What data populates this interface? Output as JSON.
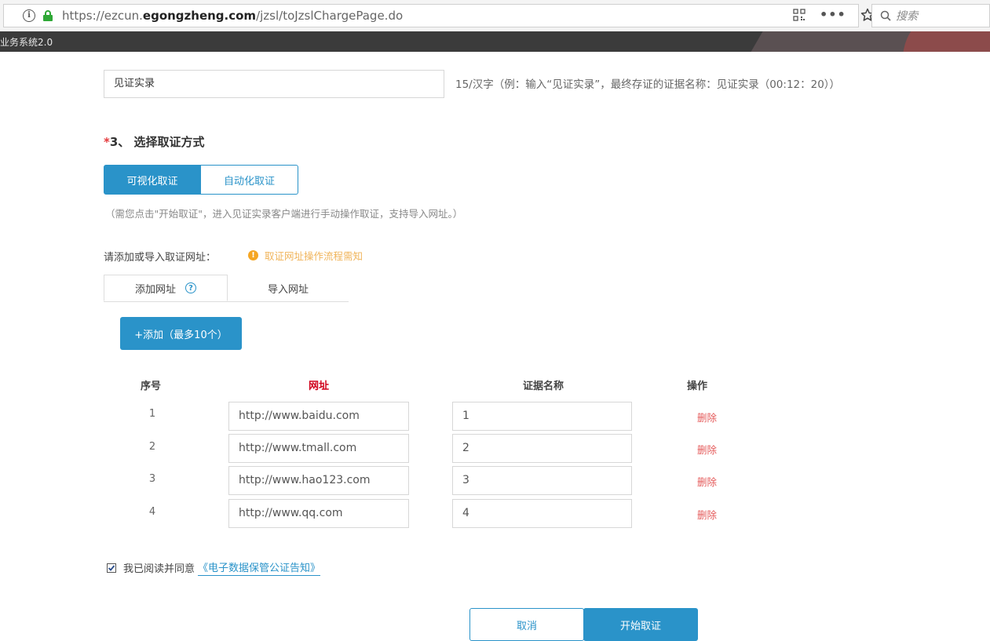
{
  "browser": {
    "url_prefix": "https://ezcun.",
    "url_domain": "egongzheng.com",
    "url_path": "/jzsl/toJzslChargePage.do",
    "search_placeholder": "搜索",
    "menu_dots": "•••",
    "tab_title": "业务系统2.0"
  },
  "form": {
    "name_value": "见证实录",
    "name_hint": "15/汉字（例：输入“见证实录”，最终存证的证据名称：见证实录（00:12：20））",
    "section_required_mark": "*",
    "section_title": "3、 选择取证方式",
    "modes": [
      "可视化取证",
      "自动化取证"
    ],
    "mode_note": "（需您点击\"开始取证\"，进入见证实录客户端进行手动操作取证，支持导入网址。）",
    "url_label": "请添加或导入取证网址：",
    "warn_text": "取证网址操作流程需知",
    "tabs": [
      "添加网址",
      "导入网址"
    ],
    "add_button": "+添加（最多10个）",
    "table": {
      "headers": [
        "序号",
        "网址",
        "证据名称",
        "操作"
      ],
      "rows": [
        {
          "index": "1",
          "url": "http://www.baidu.com",
          "name": "1",
          "action": "删除"
        },
        {
          "index": "2",
          "url": "http://www.tmall.com",
          "name": "2",
          "action": "删除"
        },
        {
          "index": "3",
          "url": "http://www.hao123.com",
          "name": "3",
          "action": "删除"
        },
        {
          "index": "4",
          "url": "http://www.qq.com",
          "name": "4",
          "action": "删除"
        }
      ]
    },
    "agree_text": "我已阅读并同意",
    "agree_link": "《电子数据保管公证告知》",
    "agree_checked": true,
    "cancel_button": "取消",
    "start_button": "开始取证"
  },
  "colors": {
    "primary": "#2a93c9",
    "required": "#e4393c",
    "delete": "#e45a5a",
    "warning": "#f5a623"
  }
}
